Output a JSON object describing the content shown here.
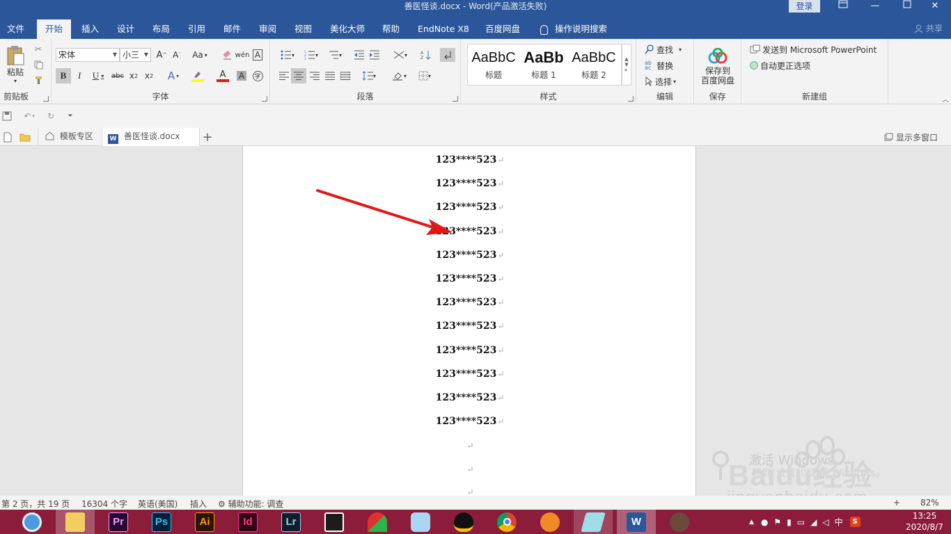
{
  "window": {
    "title": "善医怪谈.docx  -  Word(产品激活失败)",
    "login_label": "登录"
  },
  "ribbon_tabs": [
    "文件",
    "开始",
    "插入",
    "设计",
    "布局",
    "引用",
    "邮件",
    "审阅",
    "视图",
    "美化大师",
    "帮助",
    "EndNote X8",
    "百度网盘",
    "操作说明搜索"
  ],
  "share_label": "共享",
  "ribbon": {
    "clipboard": {
      "paste_label": "粘贴",
      "group_label": "剪贴板"
    },
    "font": {
      "font_name": "宋体",
      "font_size": "小三",
      "case_label": "Aa",
      "group_label": "字体"
    },
    "paragraph": {
      "group_label": "段落"
    },
    "styles": {
      "items": [
        {
          "preview": "AaBbC",
          "name": "标题"
        },
        {
          "preview": "AaBb",
          "name": "标题 1"
        },
        {
          "preview": "AaBbC",
          "name": "标题 2"
        }
      ],
      "group_label": "样式"
    },
    "editing": {
      "find": "查找",
      "replace": "替换",
      "select": "选择",
      "group_label": "编辑"
    },
    "save": {
      "button_line1": "保存到",
      "button_line2": "百度网盘",
      "group_label": "保存"
    },
    "newgroup": {
      "send_ppt": "发送到 Microsoft PowerPoint",
      "autocorrect": "自动更正选项",
      "group_label": "新建组"
    }
  },
  "doc_tabs": {
    "template_label": "模板专区",
    "doc_label": "善医怪谈.docx",
    "multi_window_label": "显示多窗口"
  },
  "document": {
    "lines": [
      "123****523",
      "123****523",
      "123****523",
      "123****523",
      "123****523",
      "123****523",
      "123****523",
      "123****523",
      "123****523",
      "123****523",
      "123****523",
      "123****523"
    ],
    "paragraph_mark": "↵"
  },
  "watermark": {
    "activate_line1": "激活 Windows",
    "activate_line2": "转到\"设置\"以激活 Windows。",
    "site": "jingyanbaidu.com",
    "brand": "Baidu经验"
  },
  "statusbar": {
    "page": "第 2 页，共 19 页",
    "words": "16304 个字",
    "language": "英语(美国)",
    "mode": "插入",
    "accessibility": "辅助功能: 调查",
    "zoom": "82%"
  },
  "taskbar": {
    "apps": [
      "Pr",
      "Ps",
      "Ai",
      "Id",
      "Lr"
    ],
    "tray_ime": "中",
    "time": "13:25",
    "date": "2020/8/7"
  },
  "colors": {
    "word_blue": "#2b579a",
    "taskbar": "#8b1d3b",
    "arrow_red": "#e01818"
  }
}
